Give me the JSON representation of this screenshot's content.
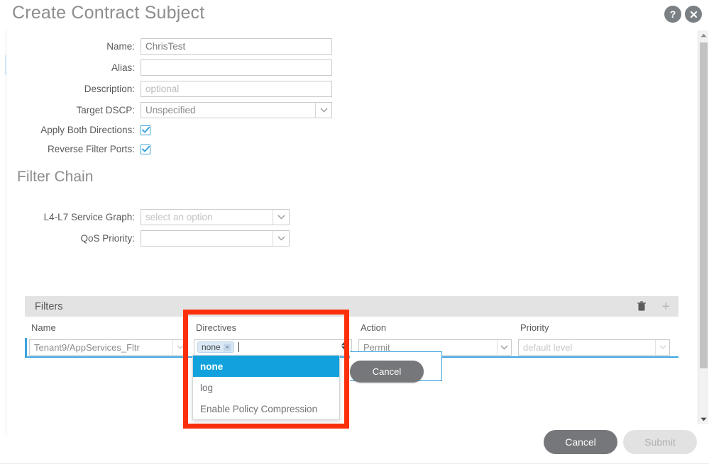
{
  "dialog": {
    "title": "Create Contract Subject",
    "help_icon": "help-icon",
    "close_icon": "close-icon"
  },
  "form": {
    "fields": [
      {
        "label": "Name:",
        "value": "ChrisTest",
        "placeholder": "",
        "type": "text"
      },
      {
        "label": "Alias:",
        "value": "",
        "placeholder": "",
        "type": "text"
      },
      {
        "label": "Description:",
        "value": "",
        "placeholder": "optional",
        "type": "text"
      },
      {
        "label": "Target DSCP:",
        "value": "Unspecified",
        "placeholder": "",
        "type": "select"
      }
    ],
    "checkboxes": [
      {
        "label": "Apply Both Directions:",
        "checked": true
      },
      {
        "label": "Reverse Filter Ports:",
        "checked": true
      }
    ]
  },
  "filter_chain": {
    "heading": "Filter Chain",
    "service_graph": {
      "label": "L4-L7 Service Graph:",
      "value": "",
      "placeholder": "select an option"
    },
    "qos_priority": {
      "label": "QoS Priority:",
      "value": "",
      "placeholder": ""
    }
  },
  "filters_panel": {
    "title": "Filters",
    "delete_icon": "trash-icon",
    "add_icon": "plus-icon",
    "columns": [
      "Name",
      "Directives",
      "Action",
      "Priority"
    ],
    "rows": [
      {
        "name": "Tenant9/AppServices_Fltr",
        "directives_chips": [
          {
            "label": "none",
            "remove": "×"
          }
        ],
        "action": "Permit",
        "priority_placeholder": "default level"
      }
    ],
    "directives_dropdown": {
      "open": true,
      "options": [
        {
          "label": "none",
          "selected": true
        },
        {
          "label": "log",
          "selected": false
        },
        {
          "label": "Enable Policy Compression",
          "selected": false
        }
      ]
    },
    "inline_cancel_label": "Cancel"
  },
  "footer": {
    "cancel_label": "Cancel",
    "submit_label": "Submit"
  },
  "colors": {
    "accent_blue": "#3ba4dd",
    "dropdown_highlight": "#11a2dd",
    "annotation_red": "#fb2f0b",
    "button_gray": "#76777a",
    "panel_header_gray": "#e3e3e3"
  }
}
